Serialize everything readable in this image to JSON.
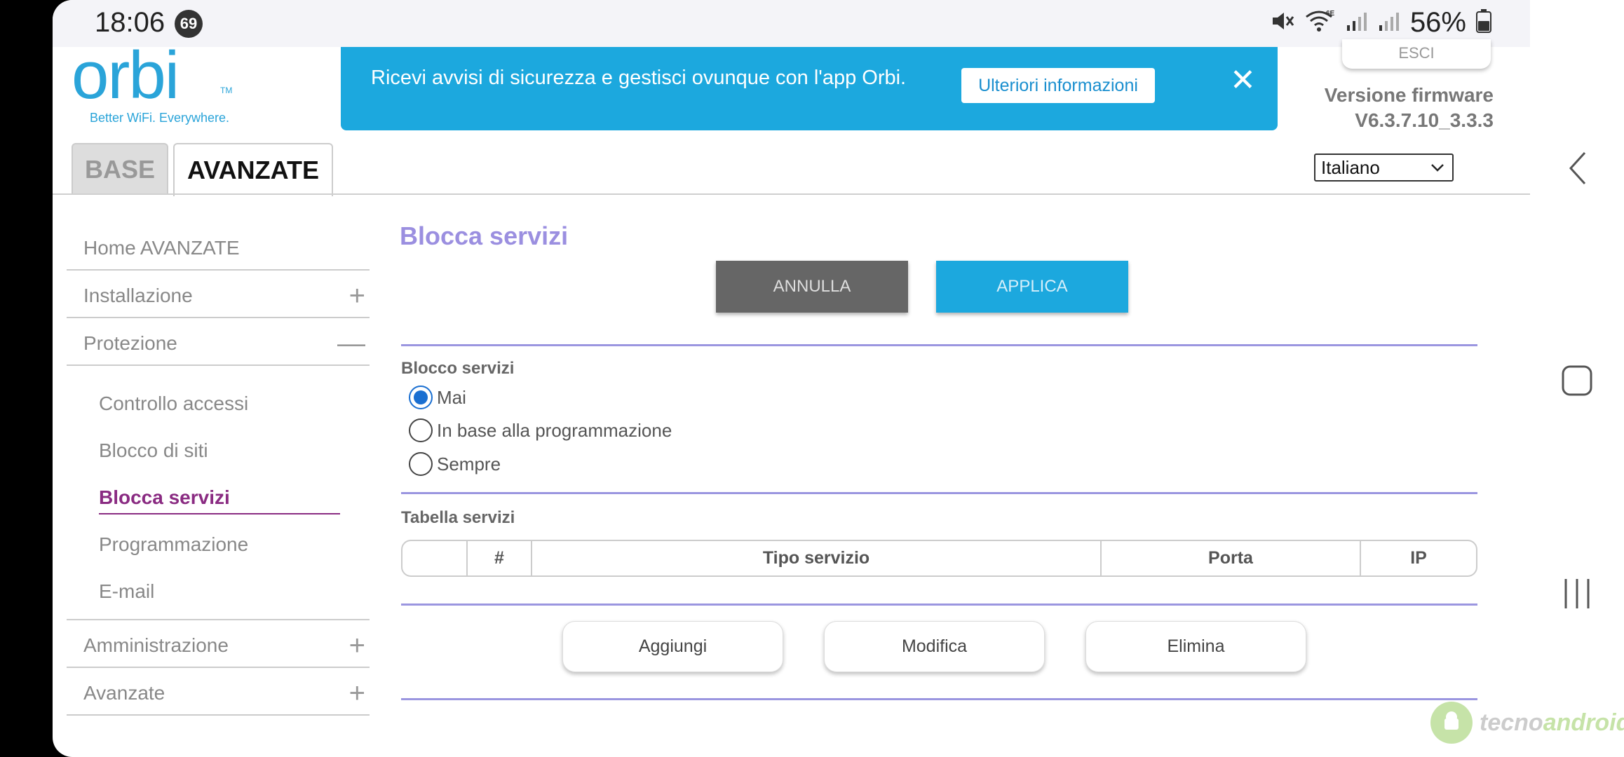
{
  "status_bar": {
    "time": "18:06",
    "notification_count": "69",
    "battery": "56%"
  },
  "logo": {
    "word": "orbi",
    "tm": "TM",
    "tagline": "Better WiFi. Everywhere."
  },
  "banner": {
    "text": "Ricevi avvisi di sicurezza e gestisci ovunque con l'app Orbi.",
    "button": "Ulteriori informazioni",
    "close": "✕"
  },
  "header": {
    "logout": "ESCI",
    "firmware_label": "Versione firmware",
    "firmware_version": "V6.3.7.10_3.3.3",
    "language": "Italiano"
  },
  "tabs": [
    {
      "label": "BASE"
    },
    {
      "label": "AVANZATE"
    }
  ],
  "sidebar": {
    "items": [
      {
        "label": "Home AVANZATE"
      },
      {
        "label": "Installazione",
        "toggle": "+"
      },
      {
        "label": "Protezione",
        "toggle": "—"
      },
      {
        "label": "Amministrazione",
        "toggle": "+"
      },
      {
        "label": "Avanzate",
        "toggle": "+"
      }
    ],
    "sub_items": [
      {
        "label": "Controllo accessi"
      },
      {
        "label": "Blocco di siti"
      },
      {
        "label": "Blocca servizi"
      },
      {
        "label": "Programmazione"
      },
      {
        "label": "E-mail"
      }
    ]
  },
  "main": {
    "title": "Blocca servizi",
    "cancel": "ANNULLA",
    "apply": "APPLICA",
    "block_section": "Blocco servizi",
    "radio_options": [
      {
        "label": "Mai",
        "checked": true
      },
      {
        "label": "In base alla programmazione",
        "checked": false
      },
      {
        "label": "Sempre",
        "checked": false
      }
    ],
    "table_section": "Tabella servizi",
    "table_headers": [
      "",
      "#",
      "Tipo servizio",
      "Porta",
      "IP"
    ],
    "actions": {
      "add": "Aggiungi",
      "edit": "Modifica",
      "delete": "Elimina"
    }
  },
  "watermark": {
    "part1": "tecno",
    "part2": "android"
  },
  "colors": {
    "brand_blue": "#1ca8de",
    "title_lavender": "#9b8fe0",
    "active_purple": "#8a2b82",
    "divider": "#9b96e0"
  }
}
